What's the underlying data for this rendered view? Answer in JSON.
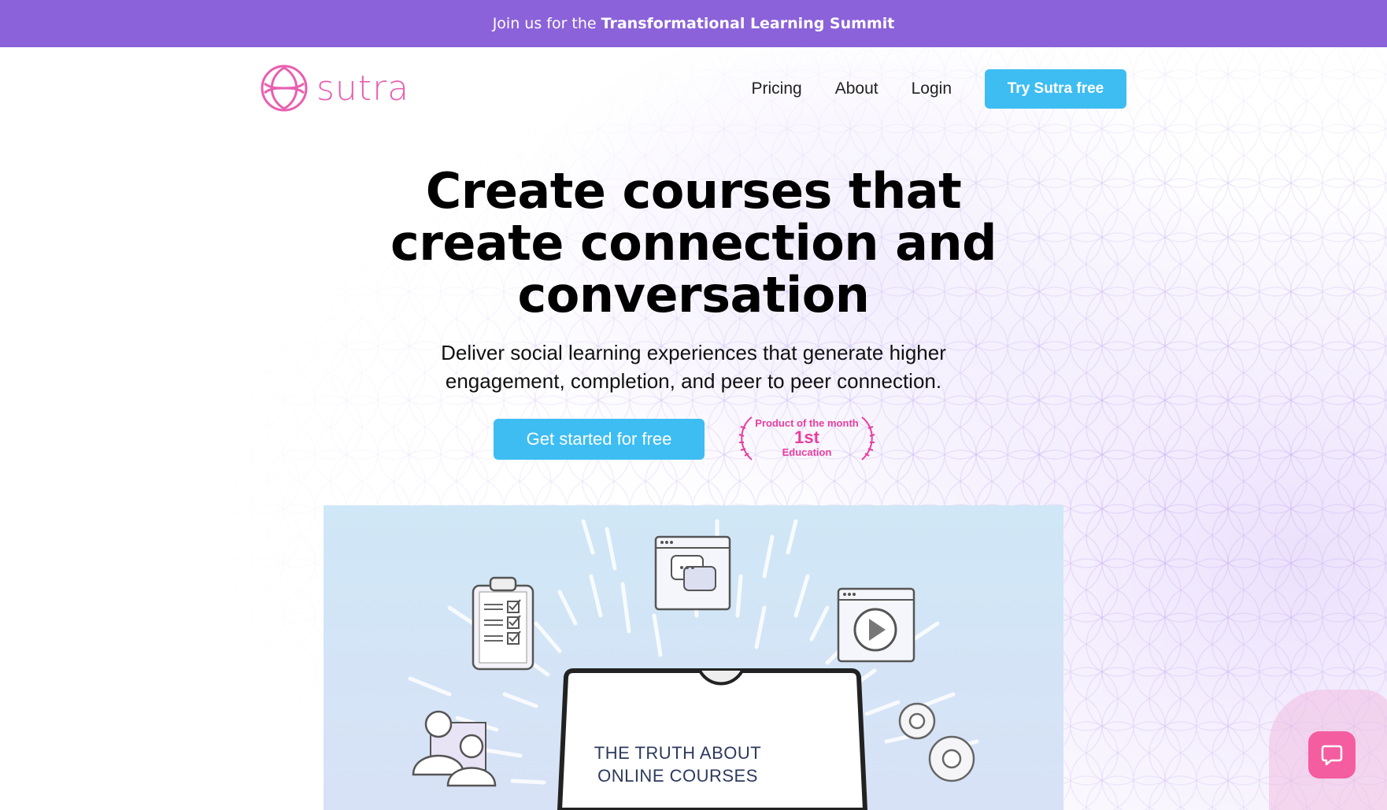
{
  "announcement": {
    "prefix": "Join us for the",
    "highlight": "Transformational Learning Summit"
  },
  "logo": {
    "text": "sutra",
    "color": "#e85fb0"
  },
  "nav": {
    "links": [
      "Pricing",
      "About",
      "Login"
    ],
    "cta": "Try Sutra free"
  },
  "hero": {
    "title_line1": "Create courses that",
    "title_line2": "create connection and",
    "title_line3": "conversation",
    "subtitle_line1": "Deliver social learning experiences that generate higher",
    "subtitle_line2": "engagement, completion, and peer to peer connection."
  },
  "cta": {
    "primary": "Get started for free"
  },
  "badge": {
    "line1": "Product of the month",
    "line2": "1st",
    "line3": "Education"
  },
  "video": {
    "title_line1": "THE TRUTH ABOUT",
    "title_line2": "ONLINE COURSES"
  },
  "colors": {
    "announcement_bg": "#8b62d9",
    "accent_blue": "#3dbdf2",
    "brand_pink": "#e85fb0",
    "chat_pink": "#f45d9f"
  },
  "icons": [
    "sutra-logo-icon",
    "laurel-left-icon",
    "laurel-right-icon",
    "clipboard-icon",
    "chat-window-icon",
    "video-player-icon",
    "people-icon",
    "gears-icon",
    "chat-bubble-icon"
  ]
}
